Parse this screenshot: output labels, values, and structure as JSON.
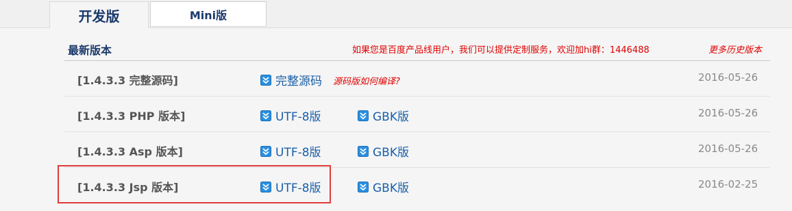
{
  "tabs": {
    "active_label": "开发版",
    "mini_label": "Mini版"
  },
  "section": {
    "title": "最新版本",
    "notice": "如果您是百度产品线用户，我们可以提供定制服务，欢迎加hi群：1446488",
    "history_link": "更多历史版本"
  },
  "colors": {
    "accent_text": "#1a3a6b",
    "link": "#1a5fa8",
    "alert": "#e00000",
    "highlight": "#e03a3a",
    "icon": "#2a8fe0"
  },
  "rows": [
    {
      "name": "[1.4.3.3 完整源码]",
      "dl_a": "完整源码",
      "hint": "源码版如何编译?",
      "date": "2016-05-26"
    },
    {
      "name": "[1.4.3.3 PHP 版本]",
      "dl_a": "UTF-8版",
      "dl_b": "GBK版",
      "date": "2016-05-26"
    },
    {
      "name": "[1.4.3.3 Asp 版本]",
      "dl_a": "UTF-8版",
      "dl_b": "GBK版",
      "date": "2016-05-26"
    },
    {
      "name": "[1.4.3.3 Jsp 版本]",
      "dl_a": "UTF-8版",
      "dl_b": "GBK版",
      "date": "2016-02-25"
    }
  ],
  "icons": {
    "download": "download-arrow-icon"
  }
}
